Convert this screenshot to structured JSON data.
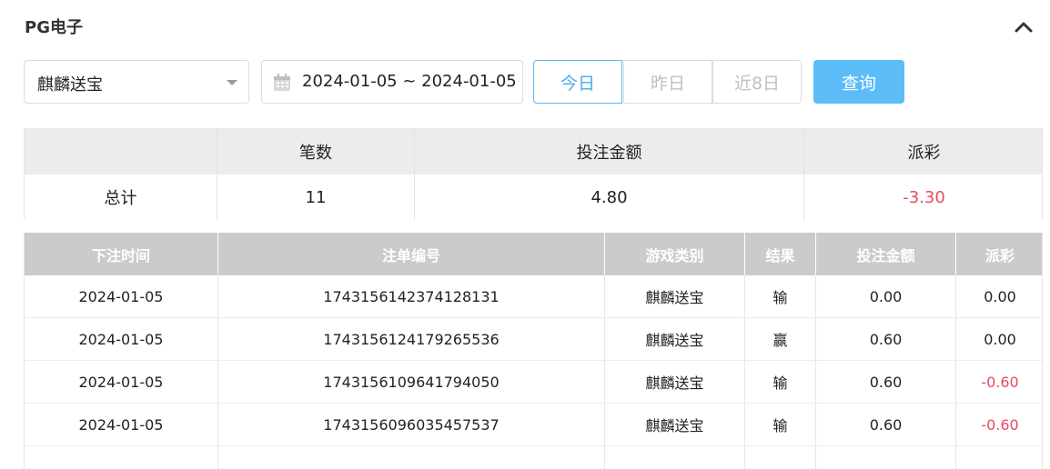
{
  "header": {
    "title": "PG电子"
  },
  "filters": {
    "game_select_value": "麒麟送宝",
    "date_range": "2024-01-05 ~ 2024-01-05",
    "quick_ranges": [
      "今日",
      "昨日",
      "近8日"
    ],
    "active_range": 0,
    "query_label": "查询"
  },
  "summary": {
    "headers": [
      "",
      "笔数",
      "投注金额",
      "派彩"
    ],
    "row": {
      "label": "总计",
      "count": "11",
      "bet": "4.80",
      "payout": "-3.30"
    }
  },
  "detail": {
    "headers": [
      "下注时间",
      "注单编号",
      "游戏类别",
      "结果",
      "投注金额",
      "派彩"
    ],
    "rows": [
      [
        "2024-01-05",
        "1743156142374128131",
        "麒麟送宝",
        "输",
        "0.00",
        "0.00"
      ],
      [
        "2024-01-05",
        "1743156124179265536",
        "麒麟送宝",
        "赢",
        "0.60",
        "0.00"
      ],
      [
        "2024-01-05",
        "1743156109641794050",
        "麒麟送宝",
        "输",
        "0.60",
        "-0.60"
      ],
      [
        "2024-01-05",
        "1743156096035457537",
        "麒麟送宝",
        "输",
        "0.60",
        "-0.60"
      ]
    ]
  },
  "colors": {
    "accent": "#5cbcf8",
    "negative": "#e84a5f",
    "table_header": "#cbcbcb"
  }
}
